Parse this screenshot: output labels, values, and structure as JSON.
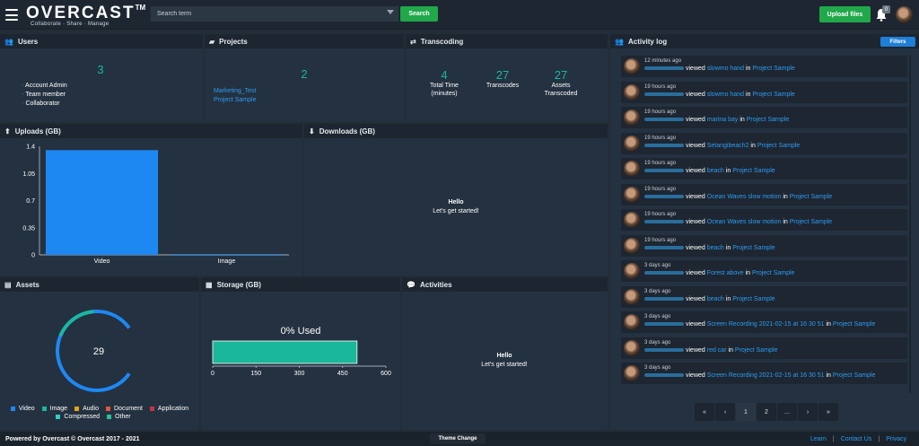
{
  "header": {
    "logo": "OVERCAST",
    "logo_tm": "TM",
    "tagline": "Collaborate · Share · Manage",
    "search_placeholder": "Search term",
    "search_label": "Search",
    "upload_label": "Upload files",
    "notifications_count": "0"
  },
  "users": {
    "title": "Users",
    "count": "3",
    "roles": [
      "Account Admin",
      "Team member",
      "Collaborator"
    ]
  },
  "projects": {
    "title": "Projects",
    "count": "2",
    "items": [
      "Marketing_Test",
      "Project Sample"
    ]
  },
  "transcoding": {
    "title": "Transcoding",
    "stats": [
      {
        "value": "4",
        "label1": "Total Time",
        "label2": "(minutes)"
      },
      {
        "value": "27",
        "label1": "Transcodes",
        "label2": ""
      },
      {
        "value": "27",
        "label1": "Assets",
        "label2": "Transcoded"
      }
    ]
  },
  "uploads": {
    "title": "Uploads (GB)"
  },
  "downloads": {
    "title": "Downloads (GB)",
    "hello": "Hello",
    "sub": "Let's get started!"
  },
  "assets": {
    "title": "Assets",
    "total": "29",
    "legend": [
      {
        "label": "Video",
        "color": "#1e88f2"
      },
      {
        "label": "Image",
        "color": "#1ab7a3"
      },
      {
        "label": "Audio",
        "color": "#e8a317"
      },
      {
        "label": "Document",
        "color": "#e0573a"
      },
      {
        "label": "Application",
        "color": "#c7324b"
      },
      {
        "label": "Compressed",
        "color": "#2ecfc4"
      },
      {
        "label": "Other",
        "color": "#27c39a"
      }
    ]
  },
  "storage": {
    "title": "Storage (GB)",
    "used_label": "0% Used",
    "bar_value": 500,
    "axis_max": 600,
    "ticks": [
      "0",
      "150",
      "300",
      "450",
      "600"
    ]
  },
  "activities": {
    "title": "Activities",
    "hello": "Hello",
    "sub": "Let's get started!"
  },
  "activity_log": {
    "title": "Activity log",
    "filters_label": "Filters",
    "verb": "viewed",
    "in_word": "in",
    "items": [
      {
        "time": "12 minutes ago",
        "asset": "slowmo hand",
        "project": "Project Sample"
      },
      {
        "time": "19 hours ago",
        "asset": "slowmo hand",
        "project": "Project Sample"
      },
      {
        "time": "19 hours ago",
        "asset": "marina bay",
        "project": "Project Sample"
      },
      {
        "time": "19 hours ago",
        "asset": "Setangibeach2",
        "project": "Project Sample"
      },
      {
        "time": "19 hours ago",
        "asset": "beach",
        "project": "Project Sample"
      },
      {
        "time": "19 hours ago",
        "asset": "Ocean Waves slow motion",
        "project": "Project Sample"
      },
      {
        "time": "19 hours ago",
        "asset": "Ocean Waves slow motion",
        "project": "Project Sample"
      },
      {
        "time": "19 hours ago",
        "asset": "beach",
        "project": "Project Sample"
      },
      {
        "time": "3 days ago",
        "asset": "Forest above",
        "project": "Project Sample"
      },
      {
        "time": "3 days ago",
        "asset": "beach",
        "project": "Project Sample"
      },
      {
        "time": "3 days ago",
        "asset": "Screen Recording 2021-02-15 at 16 30 51",
        "project": "Project Sample"
      },
      {
        "time": "3 days ago",
        "asset": "red car",
        "project": "Project Sample"
      },
      {
        "time": "3 days ago",
        "asset": "Screen Recording 2021-02-15 at 16 30 51",
        "project": "Project Sample"
      }
    ],
    "pagination": [
      "«",
      "‹",
      "1",
      "2",
      "...",
      "›",
      "»"
    ]
  },
  "footer": {
    "powered": "Powered by Overcast  ©  Overcast  2017 - 2021",
    "theme": "Theme Change",
    "links": [
      "Learn",
      "Contact Us",
      "Privacy"
    ]
  },
  "chart_data": {
    "type": "bar",
    "categories": [
      "Video",
      "Image"
    ],
    "values": [
      1.35,
      0.01
    ],
    "ylim": [
      0,
      1.4
    ],
    "yticks": [
      "1.4",
      "1.05",
      "0.7",
      "0.35",
      "0"
    ],
    "color": "#1e88f2"
  }
}
